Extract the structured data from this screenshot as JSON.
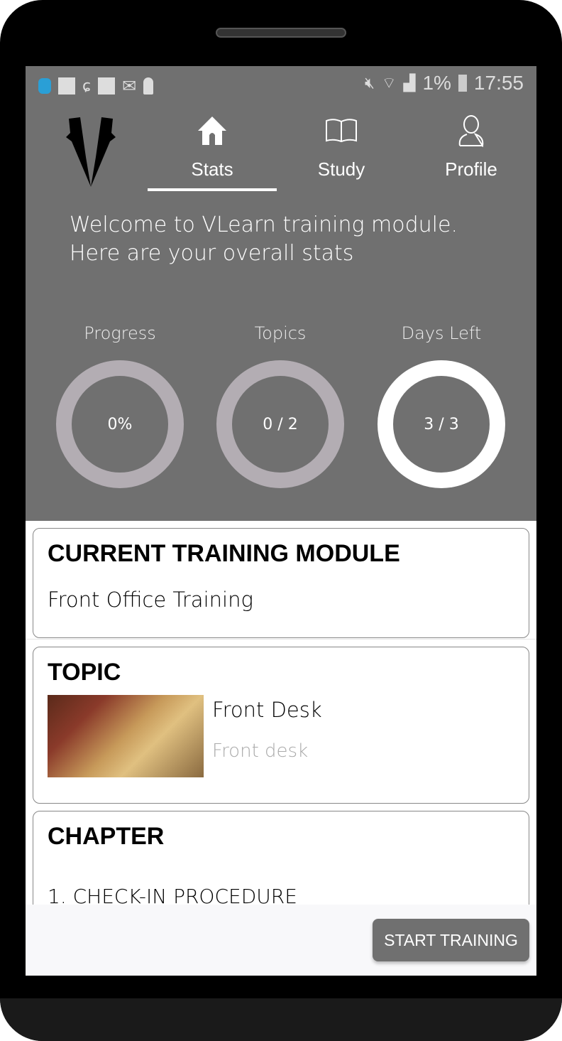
{
  "status_bar": {
    "battery": "1%",
    "time": "17:55"
  },
  "nav": {
    "tabs": [
      {
        "label": "Stats",
        "icon": "home-icon",
        "active": true
      },
      {
        "label": "Study",
        "icon": "book-icon"
      },
      {
        "label": "Profile",
        "icon": "user-icon"
      }
    ]
  },
  "welcome": {
    "line1": "Welcome to VLearn training module.",
    "line2": "Here are your overall stats"
  },
  "stats": [
    {
      "title": "Progress",
      "value": "0%"
    },
    {
      "title": "Topics",
      "value": "0 / 2"
    },
    {
      "title": "Days Left",
      "value": "3 / 3"
    }
  ],
  "colors": {
    "header": "#707070",
    "ring": "#b3adb3",
    "ring_full": "#ffffff"
  },
  "current_module": {
    "heading": "CURRENT TRAINING MODULE",
    "name": "Front Office Training"
  },
  "topic": {
    "heading": "TOPIC",
    "title": "Front Desk",
    "subtitle": "Front desk"
  },
  "chapter": {
    "heading": "CHAPTER",
    "items": [
      "1. CHECK-IN PROCEDURE"
    ]
  },
  "actions": {
    "start": "START TRAINING"
  }
}
